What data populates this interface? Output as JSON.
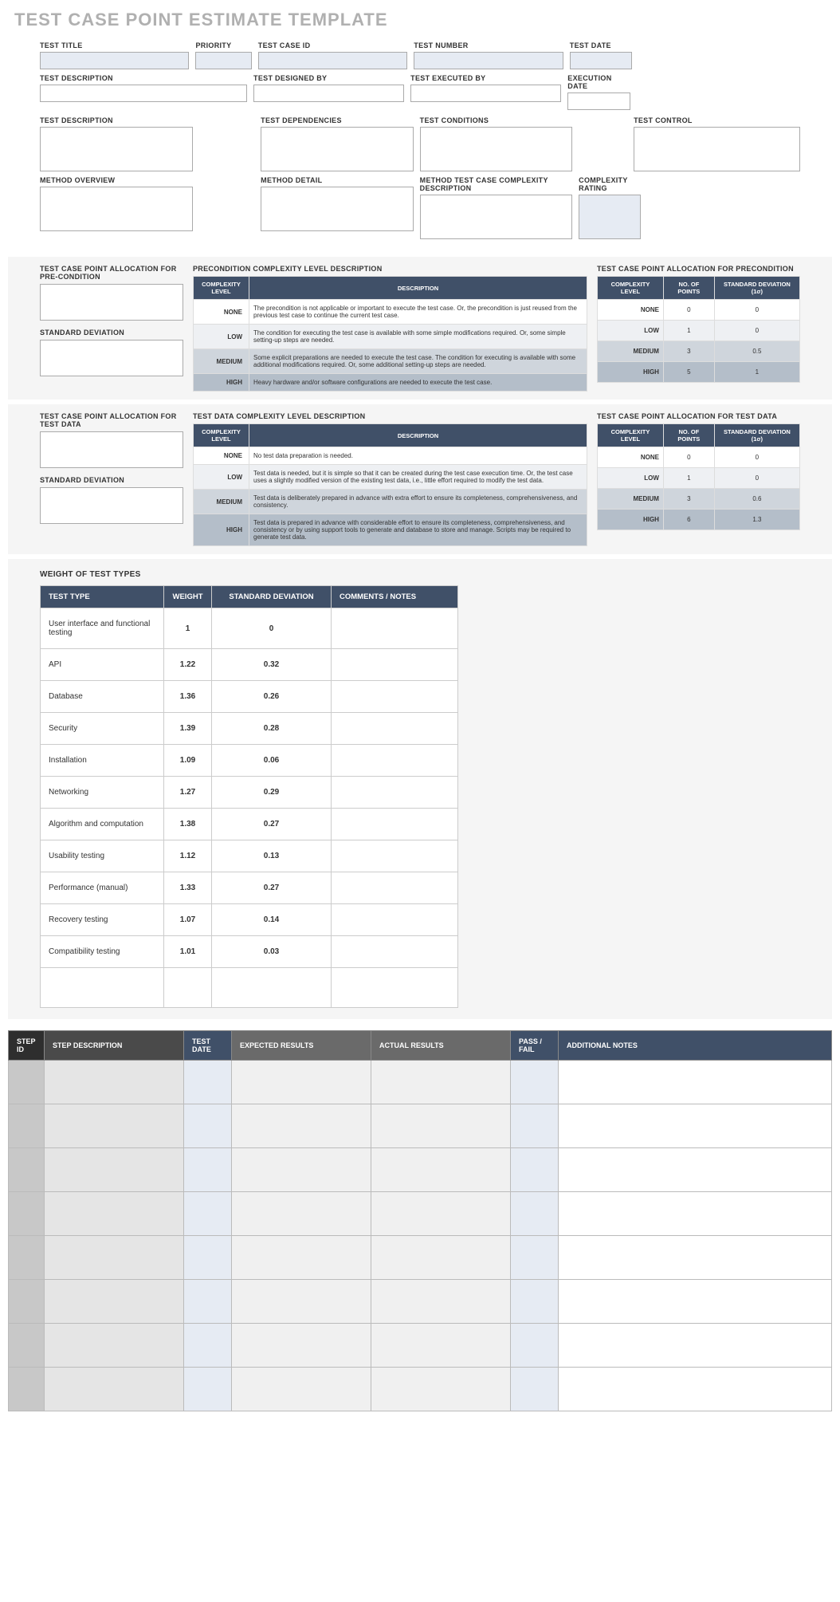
{
  "title": "TEST CASE POINT ESTIMATE TEMPLATE",
  "hdr1": {
    "testTitle": "TEST TITLE",
    "priority": "PRIORITY",
    "testCaseId": "TEST CASE ID",
    "testNumber": "TEST NUMBER",
    "testDate": "TEST DATE"
  },
  "hdr2": {
    "testDesc": "TEST DESCRIPTION",
    "designedBy": "TEST DESIGNED BY",
    "executedBy": "TEST EXECUTED BY",
    "execDate": "EXECUTION DATE"
  },
  "area1": {
    "testDesc": "TEST DESCRIPTION",
    "testDeps": "TEST DEPENDENCIES",
    "testCond": "TEST CONDITIONS",
    "testCtrl": "TEST CONTROL"
  },
  "area2": {
    "methOverview": "METHOD OVERVIEW",
    "methDetail": "METHOD DETAIL",
    "methComplex": "METHOD TEST CASE COMPLEXITY DESCRIPTION",
    "complexRating": "COMPLEXITY RATING"
  },
  "precond": {
    "allocTitle": "TEST CASE POINT ALLOCATION FOR PRE-CONDITION",
    "stdDev": "STANDARD DEVIATION",
    "descTitle": "PRECONDITION COMPLEXITY LEVEL DESCRIPTION",
    "allocRightTitle": "TEST CASE POINT ALLOCATION FOR PRECONDITION",
    "cols": {
      "lvl": "COMPLEXITY LEVEL",
      "desc": "DESCRIPTION",
      "pts": "NO. OF POINTS",
      "sd": "STANDARD DEVIATION (1σ)"
    },
    "rows": [
      {
        "lvl": "NONE",
        "desc": "The precondition is not applicable or important to execute the test case. Or, the precondition is just reused from the previous test case to continue the current test case.",
        "pts": "0",
        "sd": "0"
      },
      {
        "lvl": "LOW",
        "desc": "The condition for executing the test case is available with some simple modifications required. Or, some simple setting-up steps are needed.",
        "pts": "1",
        "sd": "0"
      },
      {
        "lvl": "MEDIUM",
        "desc": "Some explicit preparations are needed to execute the test case. The condition for executing is available with some additional modifications required. Or, some additional setting-up steps are needed.",
        "pts": "3",
        "sd": "0.5"
      },
      {
        "lvl": "HIGH",
        "desc": "Heavy hardware and/or software configurations are needed to execute the test case.",
        "pts": "5",
        "sd": "1"
      }
    ]
  },
  "testdata": {
    "allocTitle": "TEST CASE POINT ALLOCATION FOR TEST DATA",
    "stdDev": "STANDARD DEVIATION",
    "descTitle": "TEST DATA COMPLEXITY LEVEL DESCRIPTION",
    "allocRightTitle": "TEST CASE POINT ALLOCATION FOR TEST DATA",
    "cols": {
      "lvl": "COMPLEXITY LEVEL",
      "desc": "DESCRIPTION",
      "pts": "NO. OF POINTS",
      "sd": "STANDARD DEVIATION (1σ)"
    },
    "rows": [
      {
        "lvl": "NONE",
        "desc": "No test data preparation is needed.",
        "pts": "0",
        "sd": "0"
      },
      {
        "lvl": "LOW",
        "desc": "Test data is needed, but it is simple so that it can be created during the test case execution time. Or, the test case uses a slightly modified version of the existing test data, i.e., little effort required to modify the test data.",
        "pts": "1",
        "sd": "0"
      },
      {
        "lvl": "MEDIUM",
        "desc": "Test data is deliberately prepared in advance with extra effort to ensure its completeness, comprehensiveness, and consistency.",
        "pts": "3",
        "sd": "0.6"
      },
      {
        "lvl": "HIGH",
        "desc": "Test data is prepared in advance with considerable effort to ensure its completeness, comprehensiveness, and consistency or by using support tools to generate and database to store and manage. Scripts may be required to generate test data.",
        "pts": "6",
        "sd": "1.3"
      }
    ]
  },
  "weights": {
    "title": "WEIGHT OF TEST TYPES",
    "cols": {
      "type": "TEST TYPE",
      "w": "WEIGHT",
      "sd": "STANDARD DEVIATION",
      "notes": "COMMENTS / NOTES"
    },
    "rows": [
      {
        "type": "User interface and functional testing",
        "w": "1",
        "sd": "0"
      },
      {
        "type": "API",
        "w": "1.22",
        "sd": "0.32"
      },
      {
        "type": "Database",
        "w": "1.36",
        "sd": "0.26"
      },
      {
        "type": "Security",
        "w": "1.39",
        "sd": "0.28"
      },
      {
        "type": "Installation",
        "w": "1.09",
        "sd": "0.06"
      },
      {
        "type": "Networking",
        "w": "1.27",
        "sd": "0.29"
      },
      {
        "type": "Algorithm and computation",
        "w": "1.38",
        "sd": "0.27"
      },
      {
        "type": "Usability testing",
        "w": "1.12",
        "sd": "0.13"
      },
      {
        "type": "Performance (manual)",
        "w": "1.33",
        "sd": "0.27"
      },
      {
        "type": "Recovery testing",
        "w": "1.07",
        "sd": "0.14"
      },
      {
        "type": "Compatibility testing",
        "w": "1.01",
        "sd": "0.03"
      }
    ]
  },
  "steps": {
    "cols": {
      "id": "STEP ID",
      "desc": "STEP DESCRIPTION",
      "date": "TEST DATE",
      "exp": "EXPECTED RESULTS",
      "act": "ACTUAL RESULTS",
      "pf": "PASS / FAIL",
      "notes": "ADDITIONAL NOTES"
    },
    "rowCount": 8
  }
}
